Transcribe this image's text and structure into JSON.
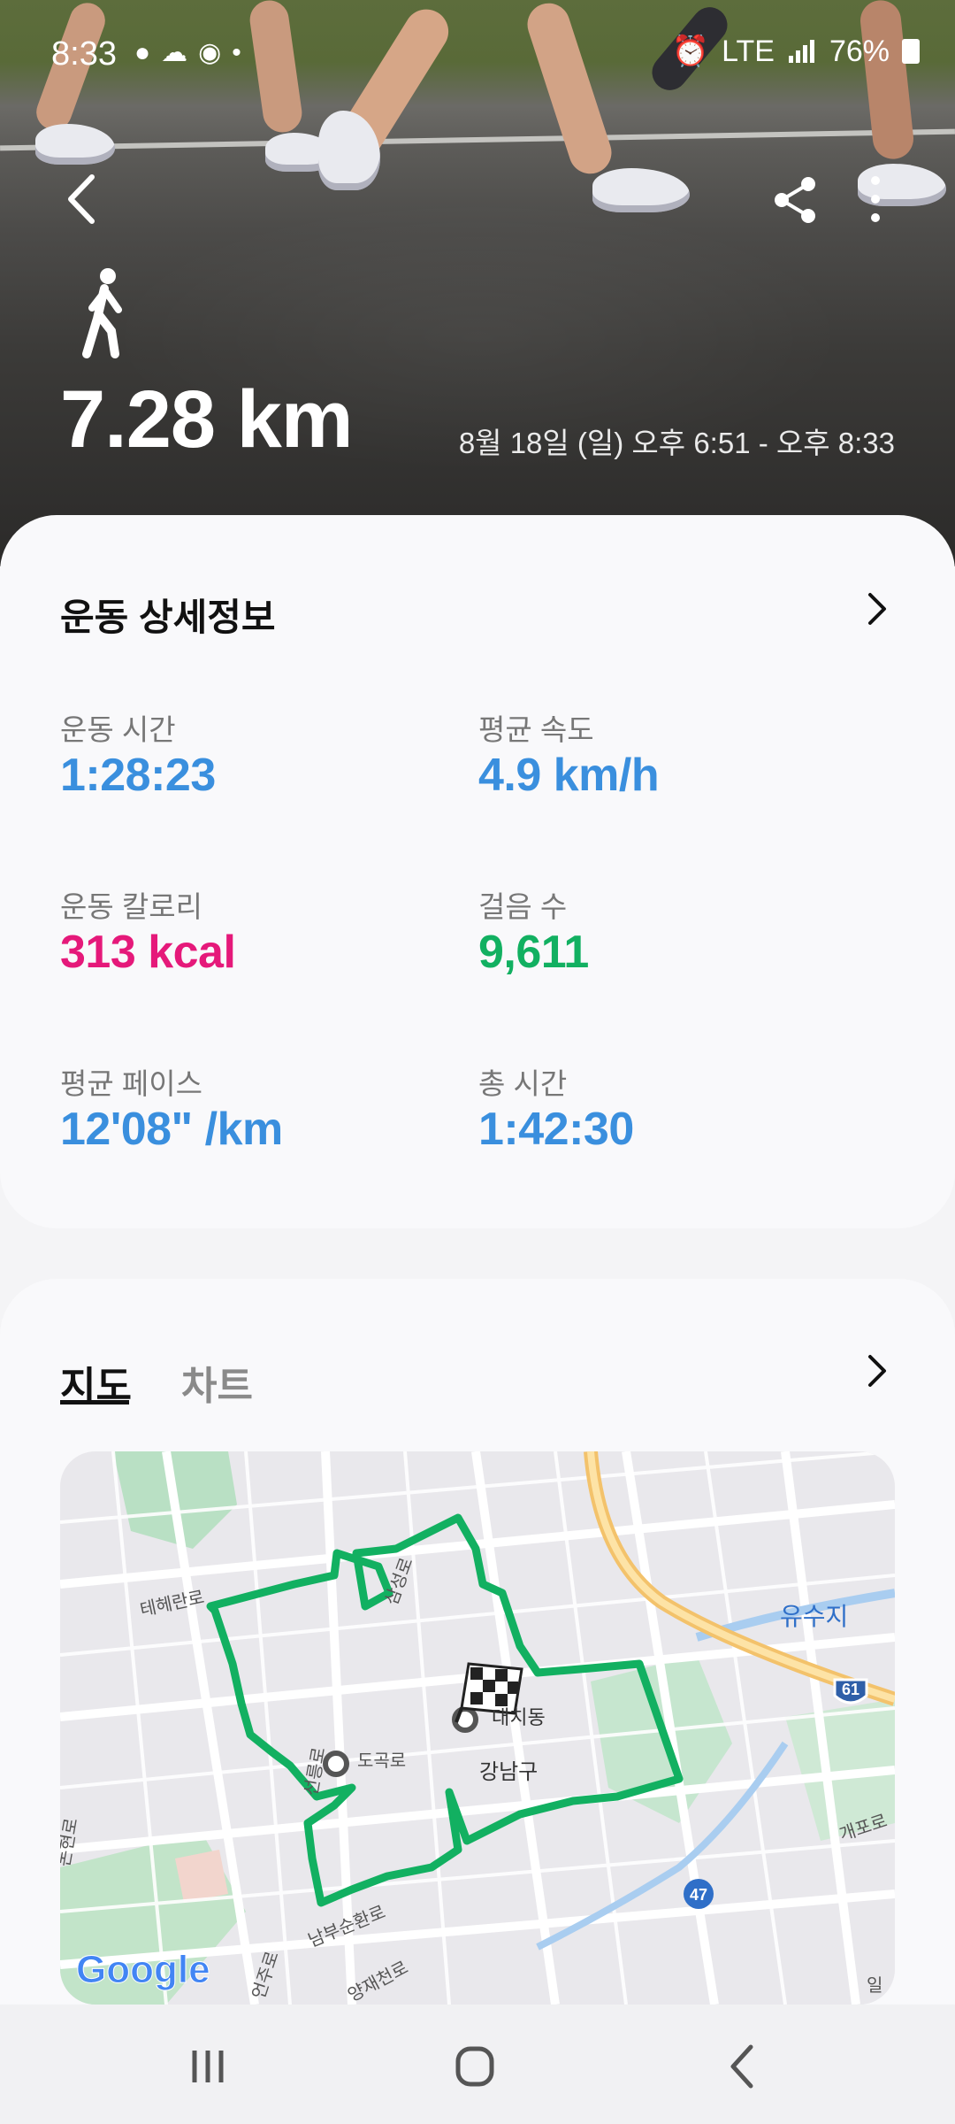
{
  "status_bar": {
    "time": "8:33",
    "network": "LTE",
    "battery": "76%"
  },
  "header": {
    "activity_icon": "walking-person-icon",
    "distance": "7.28 km",
    "date_range": "8월 18일 (일) 오후 6:51 - 오후 8:33"
  },
  "details": {
    "title": "운동 상세정보",
    "stats": [
      {
        "label": "운동 시간",
        "value": "1:28:23",
        "color": "#3a8fde"
      },
      {
        "label": "평균 속도",
        "value": "4.9 km/h",
        "color": "#3a8fde"
      },
      {
        "label": "운동 칼로리",
        "value": "313 kcal",
        "color": "#e5197a"
      },
      {
        "label": "걸음 수",
        "value": "9,611",
        "color": "#12b061"
      },
      {
        "label": "평균 페이스",
        "value": "12'08\" /km",
        "color": "#3a8fde"
      },
      {
        "label": "총 시간",
        "value": "1:42:30",
        "color": "#3a8fde"
      }
    ]
  },
  "map_section": {
    "tabs": [
      "지도",
      "차트"
    ],
    "active_tab": "지도",
    "map_labels": {
      "teheran": "테헤란로",
      "samseong": "삼성로",
      "dogok": "도곡로",
      "seolleung": "선릉로",
      "daechi": "대치동",
      "gangnam": "강남구",
      "nambu": "남부순환로",
      "yangjae": "양재천로",
      "eonju": "언주로",
      "nonhyeon": "논현로",
      "gaepo": "개포로",
      "yusuji": "유수지",
      "route61": "61",
      "route47": "47",
      "il": "일",
      "google": "Google"
    },
    "route_color": "#12b061"
  }
}
